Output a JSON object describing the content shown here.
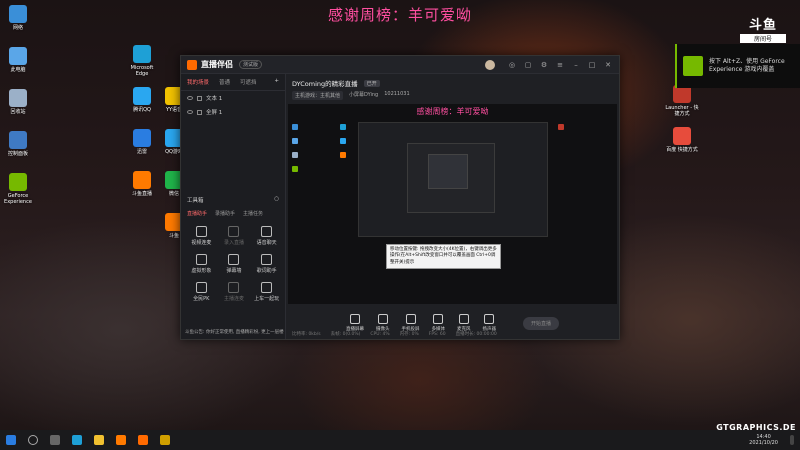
{
  "overlay_title": "感谢周榜：羊可爱呦",
  "room_badge": {
    "logo": "斗鱼",
    "tag": "房间号",
    "number": "10211031"
  },
  "nvidia_toast": {
    "text": "按下 Alt+Z、使用 GeForce Experience 游戏内覆盖"
  },
  "desktop_icons_left": [
    {
      "label": "网络",
      "color": "#3a8fd8"
    },
    {
      "label": "此电脑",
      "color": "#5aa6e8"
    },
    {
      "label": "回收站",
      "color": "#9bb0c8"
    },
    {
      "label": "控制面板",
      "color": "#3f7ac4"
    },
    {
      "label": "GeForce Experience",
      "color": "#76b900"
    }
  ],
  "desktop_icons_col2": [
    {
      "label": "Microsoft Edge",
      "color": "#1ea0d6"
    },
    {
      "label": "腾讯QQ",
      "color": "#2aa7f0"
    },
    {
      "label": "迅雷",
      "color": "#2a7de1"
    },
    {
      "label": "斗鱼直播",
      "color": "#ff7a00"
    }
  ],
  "desktop_icons_col3": [
    {
      "label": "YY语音",
      "color": "#f2c200"
    },
    {
      "label": "QQ游戏",
      "color": "#2aa7f0"
    },
    {
      "label": "微信",
      "color": "#20b54a"
    },
    {
      "label": "斗鱼",
      "color": "#ff7a00"
    }
  ],
  "desktop_icons_right": [
    {
      "label": "Launcher - 快捷方式",
      "color": "#c0392b"
    },
    {
      "label": "百度 快捷方式",
      "color": "#e74c3c"
    }
  ],
  "app": {
    "brand": "直播伴侣",
    "version": "测试版",
    "left_tabs": [
      "我的场景",
      "普通",
      "可遮挡"
    ],
    "scenes": [
      "文本 1",
      "全屏 1"
    ],
    "tools_title": "工具箱",
    "tools_tabs": [
      "直播助手",
      "录播助手",
      "主播任务"
    ],
    "tools": [
      {
        "label": "视频连麦",
        "dim": false
      },
      {
        "label": "录入直播",
        "dim": true
      },
      {
        "label": "语音聊天",
        "dim": false
      },
      {
        "label": "虚拟形象",
        "dim": false
      },
      {
        "label": "弹幕墙",
        "dim": false
      },
      {
        "label": "歌词助手",
        "dim": false
      },
      {
        "label": "全民PK",
        "dim": false
      },
      {
        "label": "主播连麦",
        "dim": true
      },
      {
        "label": "上车一起玩",
        "dim": false
      }
    ],
    "left_footer": "斗鱼公告: 你好正常使用, 直播精彩纷, 更上一层楼",
    "room_title": "DYComing的精彩直播",
    "room_badge": "已开",
    "room_sub": [
      "主机游戏：主机其他",
      "小屏幕DYing",
      "10211031"
    ],
    "preview_title": "感谢周榜：羊可爱呦",
    "tooltip": "移动位置按键: 拖拽改变大小(4K位置)，右键调出更多操作(在Alt+Shift改变窗口并可以覆盖画面 Ctrl+0调整开关)提示",
    "bottom_buttons": [
      "直播屏幕",
      "摄像头",
      "手机投屏",
      "多媒体",
      "麦克风",
      "扬声器"
    ],
    "start_button": "开始直播",
    "status": [
      "比特率: 0kb/s",
      "丢帧: 0(0.0%)",
      "CPU: 4%",
      "内存: 0%",
      "FPS: 60",
      "直播时长: 00:00:00"
    ]
  },
  "taskbar": {
    "time": "14:40",
    "date": "2021/10/20"
  },
  "watermark": "GTGRAPHICS.DE"
}
